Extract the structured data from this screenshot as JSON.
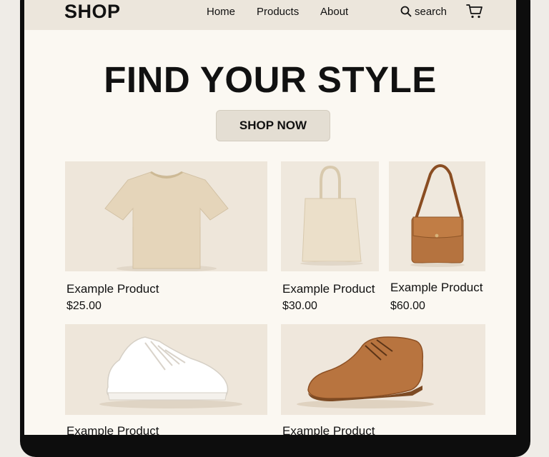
{
  "header": {
    "logo": "SHOP",
    "nav": [
      "Home",
      "Products",
      "About"
    ],
    "search_label": "search"
  },
  "hero": {
    "title": "FIND YOUR STYLE",
    "cta_label": "SHOP NOW"
  },
  "products": [
    {
      "name": "Example Product",
      "price": "$25.00",
      "image": "t-shirt"
    },
    {
      "name": "Example Product",
      "price": "$30.00",
      "image": "tote-bag"
    },
    {
      "name": "Example Product",
      "price": "$60.00",
      "image": "leather-shoulder-bag"
    },
    {
      "name": "Example Product",
      "price": "",
      "image": "white-sneaker"
    },
    {
      "name": "Example Product",
      "price": "",
      "image": "brown-oxford-shoe"
    }
  ],
  "colors": {
    "background": "#fbf8f2",
    "header": "#ece6dc",
    "button": "#e4ded3",
    "image_bg": "#efe7dc",
    "text": "#111111"
  }
}
